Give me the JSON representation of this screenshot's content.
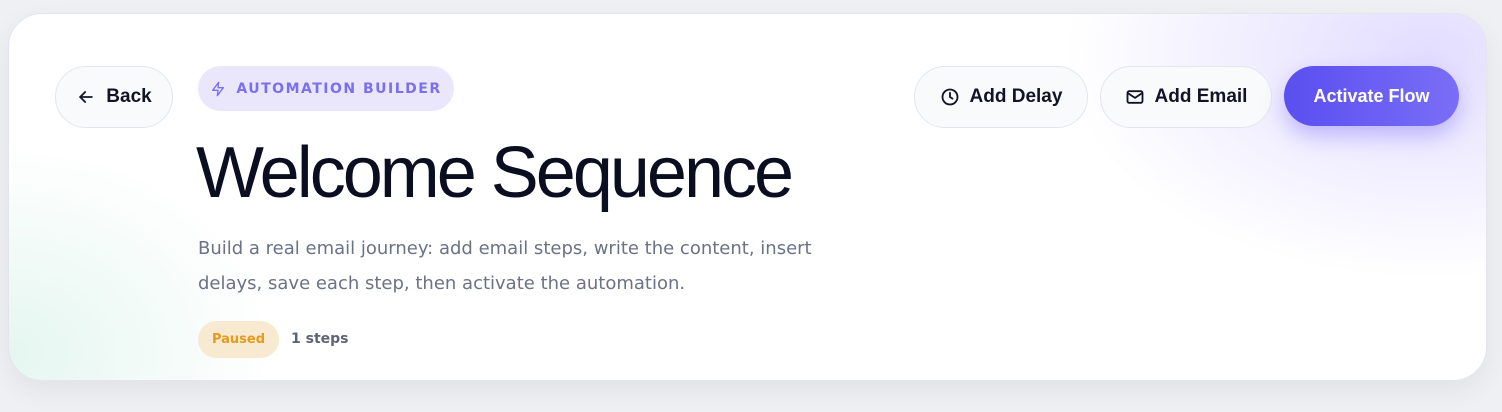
{
  "header": {
    "back_label": "Back",
    "badge_label": "AUTOMATION BUILDER",
    "title": "Welcome Sequence",
    "description": "Build a real email journey: add email steps, write the content, insert delays, save each step, then activate the automation.",
    "status": "Paused",
    "steps_count": "1 steps"
  },
  "actions": {
    "add_delay_label": "Add Delay",
    "add_email_label": "Add Email",
    "activate_label": "Activate Flow"
  },
  "icons": {
    "back": "arrow-left-icon",
    "badge": "lightning-icon",
    "delay": "clock-icon",
    "email": "mail-icon"
  },
  "colors": {
    "accent": "#6356f5",
    "badge_bg": "#eae7fd",
    "badge_text": "#7b6ff0",
    "status_bg": "#f7ead0",
    "status_text": "#e59a1e",
    "title": "#0a0e20"
  }
}
